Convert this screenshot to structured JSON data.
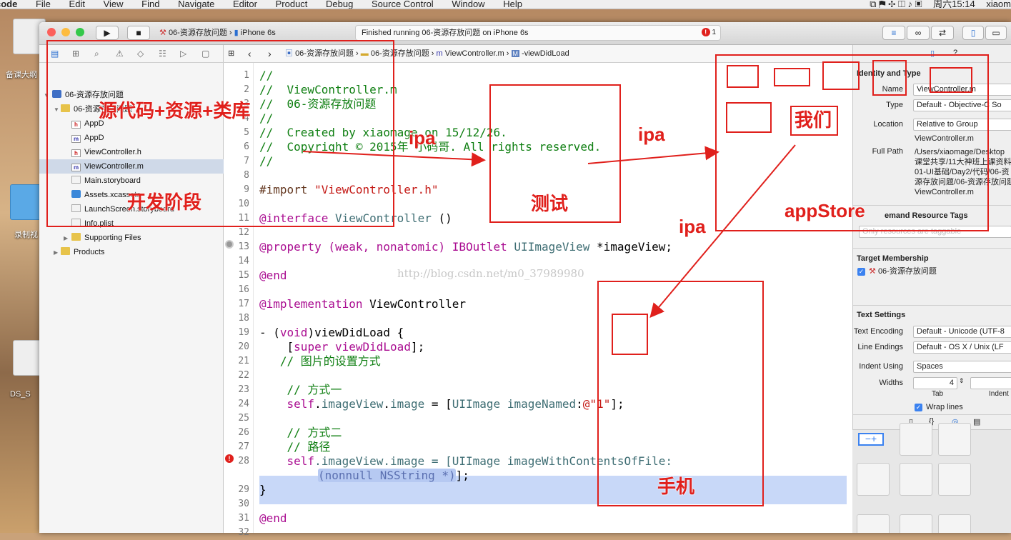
{
  "menubar": {
    "app": "code",
    "items": [
      "File",
      "Edit",
      "View",
      "Find",
      "Navigate",
      "Editor",
      "Product",
      "Debug",
      "Source Control",
      "Window",
      "Help"
    ],
    "clock": "周六15:14",
    "user": "xiaom"
  },
  "desktop": {
    "labels": [
      "备课大纲",
      "录制视",
      "DS_S"
    ]
  },
  "toolbar": {
    "scheme_project": "06-资源存放问题",
    "scheme_device": "iPhone 6s",
    "activity": "Finished running 06-资源存放问题 on iPhone 6s",
    "error_count": "1"
  },
  "navigator": {
    "rows": [
      {
        "label": "06-资源存放问题",
        "kind": "project"
      },
      {
        "label": "06-资源存放问题",
        "kind": "folder"
      },
      {
        "label": "AppD",
        "kind": "h"
      },
      {
        "label": "AppD",
        "kind": "m"
      },
      {
        "label": "ViewController.h",
        "kind": "h"
      },
      {
        "label": "ViewController.m",
        "kind": "m"
      },
      {
        "label": "Main.storyboard",
        "kind": "sb"
      },
      {
        "label": "Assets.xcassets",
        "kind": "xc"
      },
      {
        "label": "LaunchScreen.storyboard",
        "kind": "sb"
      },
      {
        "label": "Info.plist",
        "kind": "sb"
      },
      {
        "label": "Supporting Files",
        "kind": "folder"
      },
      {
        "label": "Products",
        "kind": "folder"
      }
    ]
  },
  "jumpbar": {
    "crumbs": [
      "06-资源存放问题",
      "06-资源存放问题",
      "ViewController.m",
      "-viewDidLoad"
    ]
  },
  "editor": {
    "line_numbers": [
      "1",
      "2",
      "3",
      "4",
      "5",
      "6",
      "7",
      "8",
      "9",
      "10",
      "11",
      "12",
      "13",
      "14",
      "15",
      "16",
      "17",
      "18",
      "19",
      "20",
      "21",
      "22",
      "23",
      "24",
      "25",
      "26",
      "27",
      "28",
      "",
      "29",
      "30",
      "31",
      "32"
    ],
    "lines": {
      "l1": "//",
      "l2": "//  ViewController.m",
      "l3": "//  06-资源存放问题",
      "l4": "//",
      "l5": "//  Created by xiaomage on 15/12/26.",
      "l6": "//  Copyright © 2015年 小码哥. All rights reserved.",
      "l7": "//",
      "l9a": "#import ",
      "l9b": "\"ViewController.h\"",
      "l11a": "@interface ",
      "l11b": "ViewController",
      "l11c": " ()",
      "l13a": "@property ",
      "l13b": "(weak, nonatomic) ",
      "l13c": "IBOutlet ",
      "l13d": "UIImageView",
      "l13e": " *imageView;",
      "l15": "@end",
      "l17a": "@implementation ",
      "l17b": "ViewController",
      "l19a": "- (",
      "l19b": "void",
      "l19c": ")viewDidLoad {",
      "l20a": "    [",
      "l20b": "super",
      "l20c": " ",
      "l20d": "viewDidLoad",
      "l20e": "];",
      "l21": "   // 图片的设置方式",
      "l23": "    // 方式一",
      "l24a": "    ",
      "l24b": "self",
      "l24c": ".",
      "l24d": "imageView",
      "l24e": ".",
      "l24f": "image",
      "l24g": " = [",
      "l24h": "UIImage",
      "l24i": " ",
      "l24j": "imageNamed",
      "l24k": ":",
      "l24l": "@\"1\"",
      "l24m": "];",
      "l27": "    // 方式二",
      "l28c": "    // 路径",
      "l28a": "    ",
      "l28b": "self",
      "l28d": ".imageView.image = [",
      "l28e": "UIImage",
      "l28f": " imageWithContentsOfFile:",
      "l28g": "(nonnull NSString *)",
      "l28h": "];",
      "l29": "}",
      "l31": "@end"
    },
    "watermark": "http://blog.csdn.net/m0_37989980"
  },
  "inspector": {
    "section_identity": "Identity and Type",
    "name_label": "Name",
    "name_value": "ViewController.m",
    "type_label": "Type",
    "type_value": "Default - Objective-C So",
    "location_label": "Location",
    "location_value": "Relative to Group",
    "location_file": "ViewController.m",
    "fullpath_label": "Full Path",
    "fullpath_lines": [
      "/Users/xiaomage/Desktop",
      "课堂共享/11大神班上课资料",
      "01-UI基础/Day2/代码/06-资",
      "源存放问题/06-资源存放问题",
      "ViewController.m"
    ],
    "section_odr": "emand Resource Tags",
    "odr_placeholder": "Only resources are taggable",
    "section_target": "Target Membership",
    "target_name": "06-资源存放问题",
    "section_text": "Text Settings",
    "encoding_label": "Text Encoding",
    "encoding_value": "Default - Unicode (UTF-8",
    "endings_label": "Line Endings",
    "endings_value": "Default - OS X / Unix (LF",
    "indent_label": "Indent Using",
    "indent_value": "Spaces",
    "widths_label": "Widths",
    "tab_value": "4",
    "tab_label": "Tab",
    "indent_sub_label": "Indent",
    "wrap_label": "Wrap lines"
  },
  "annotations": {
    "source": "源代码+资源+类库",
    "dev": "开发阶段",
    "ipa1": "ipa",
    "ipa2": "ipa",
    "ipa3": "ipa",
    "test": "测试",
    "we": "我们",
    "appstore": "appStore",
    "phone": "手机",
    "color": "#e0201c"
  }
}
